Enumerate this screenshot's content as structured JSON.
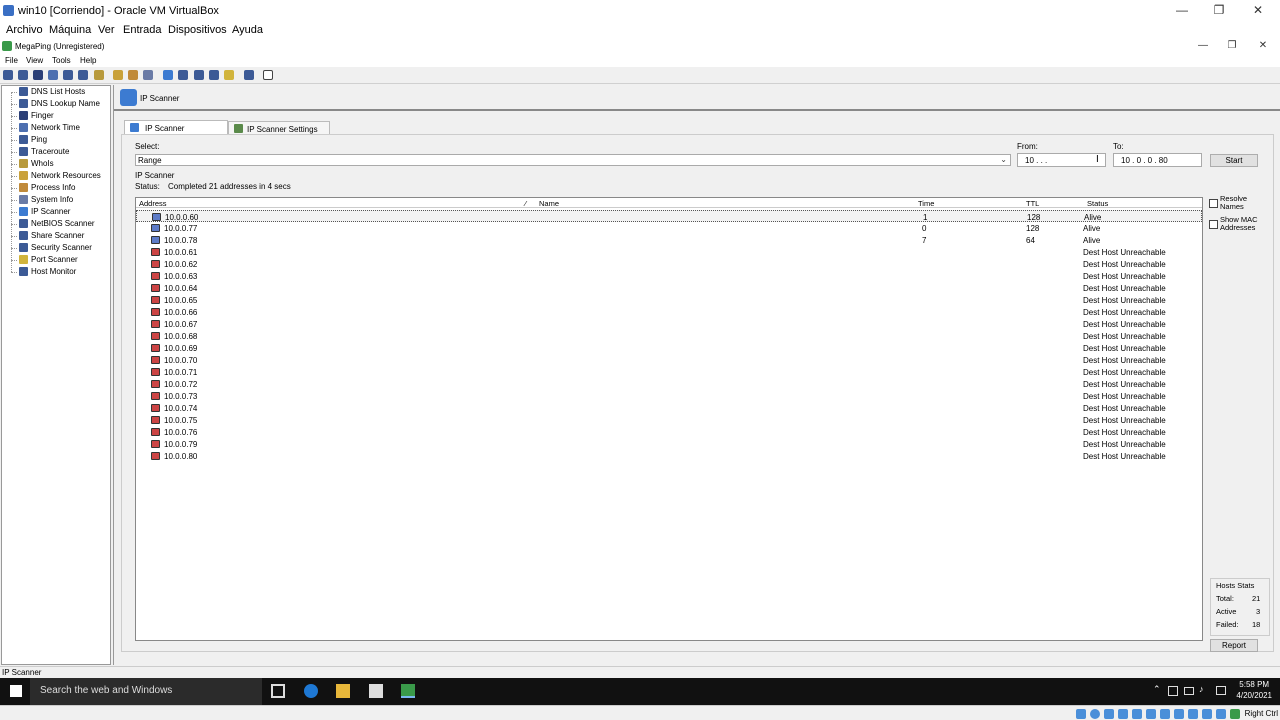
{
  "vbox": {
    "title": "win10 [Corriendo] - Oracle VM VirtualBox",
    "menu": [
      "Archivo",
      "Máquina",
      "Ver",
      "Entrada",
      "Dispositivos",
      "Ayuda"
    ],
    "host_key": "Right Ctrl"
  },
  "app": {
    "title": "MegaPing (Unregistered)",
    "menu": [
      "File",
      "View",
      "Tools",
      "Help"
    ]
  },
  "tree": {
    "items": [
      "DNS List Hosts",
      "DNS Lookup Name",
      "Finger",
      "Network Time",
      "Ping",
      "Traceroute",
      "WhoIs",
      "Network Resources",
      "Process Info",
      "System Info",
      "IP Scanner",
      "NetBIOS Scanner",
      "Share Scanner",
      "Security Scanner",
      "Port Scanner",
      "Host Monitor"
    ]
  },
  "panel": {
    "header_title": "IP Scanner",
    "tabs": [
      "IP Scanner",
      "IP Scanner Settings"
    ],
    "select_label": "Select:",
    "select_value": "Range",
    "from_label": "From:",
    "from_value": "10 .  .  .",
    "to_label": "To:",
    "to_value": "10 .  0  .  0  .  80",
    "start_label": "Start",
    "group_label": "IP Scanner",
    "status_label": "Status:",
    "status_value": "Completed 21 addresses in 4 secs",
    "resolve_names": "Resolve Names",
    "show_mac": "Show MAC Addresses",
    "report_label": "Report",
    "stats": {
      "title": "Hosts Stats",
      "total_label": "Total:",
      "total": "21",
      "active_label": "Active",
      "active": "3",
      "failed_label": "Failed:",
      "failed": "18"
    }
  },
  "table": {
    "columns": [
      "Address",
      "Name",
      "Time",
      "TTL",
      "Status"
    ],
    "rows": [
      {
        "address": "10.0.0.60",
        "time": "1",
        "ttl": "128",
        "status": "Alive",
        "alive": true
      },
      {
        "address": "10.0.0.77",
        "time": "0",
        "ttl": "128",
        "status": "Alive",
        "alive": true
      },
      {
        "address": "10.0.0.78",
        "time": "7",
        "ttl": "64",
        "status": "Alive",
        "alive": true
      },
      {
        "address": "10.0.0.61",
        "time": "",
        "ttl": "",
        "status": "Dest Host Unreachable",
        "alive": false
      },
      {
        "address": "10.0.0.62",
        "time": "",
        "ttl": "",
        "status": "Dest Host Unreachable",
        "alive": false
      },
      {
        "address": "10.0.0.63",
        "time": "",
        "ttl": "",
        "status": "Dest Host Unreachable",
        "alive": false
      },
      {
        "address": "10.0.0.64",
        "time": "",
        "ttl": "",
        "status": "Dest Host Unreachable",
        "alive": false
      },
      {
        "address": "10.0.0.65",
        "time": "",
        "ttl": "",
        "status": "Dest Host Unreachable",
        "alive": false
      },
      {
        "address": "10.0.0.66",
        "time": "",
        "ttl": "",
        "status": "Dest Host Unreachable",
        "alive": false
      },
      {
        "address": "10.0.0.67",
        "time": "",
        "ttl": "",
        "status": "Dest Host Unreachable",
        "alive": false
      },
      {
        "address": "10.0.0.68",
        "time": "",
        "ttl": "",
        "status": "Dest Host Unreachable",
        "alive": false
      },
      {
        "address": "10.0.0.69",
        "time": "",
        "ttl": "",
        "status": "Dest Host Unreachable",
        "alive": false
      },
      {
        "address": "10.0.0.70",
        "time": "",
        "ttl": "",
        "status": "Dest Host Unreachable",
        "alive": false
      },
      {
        "address": "10.0.0.71",
        "time": "",
        "ttl": "",
        "status": "Dest Host Unreachable",
        "alive": false
      },
      {
        "address": "10.0.0.72",
        "time": "",
        "ttl": "",
        "status": "Dest Host Unreachable",
        "alive": false
      },
      {
        "address": "10.0.0.73",
        "time": "",
        "ttl": "",
        "status": "Dest Host Unreachable",
        "alive": false
      },
      {
        "address": "10.0.0.74",
        "time": "",
        "ttl": "",
        "status": "Dest Host Unreachable",
        "alive": false
      },
      {
        "address": "10.0.0.75",
        "time": "",
        "ttl": "",
        "status": "Dest Host Unreachable",
        "alive": false
      },
      {
        "address": "10.0.0.76",
        "time": "",
        "ttl": "",
        "status": "Dest Host Unreachable",
        "alive": false
      },
      {
        "address": "10.0.0.79",
        "time": "",
        "ttl": "",
        "status": "Dest Host Unreachable",
        "alive": false
      },
      {
        "address": "10.0.0.80",
        "time": "",
        "ttl": "",
        "status": "Dest Host Unreachable",
        "alive": false
      }
    ]
  },
  "statusbar": {
    "text": "IP Scanner"
  },
  "taskbar": {
    "search_placeholder": "Search the web and Windows",
    "time": "5:58 PM",
    "date": "4/20/2021"
  }
}
